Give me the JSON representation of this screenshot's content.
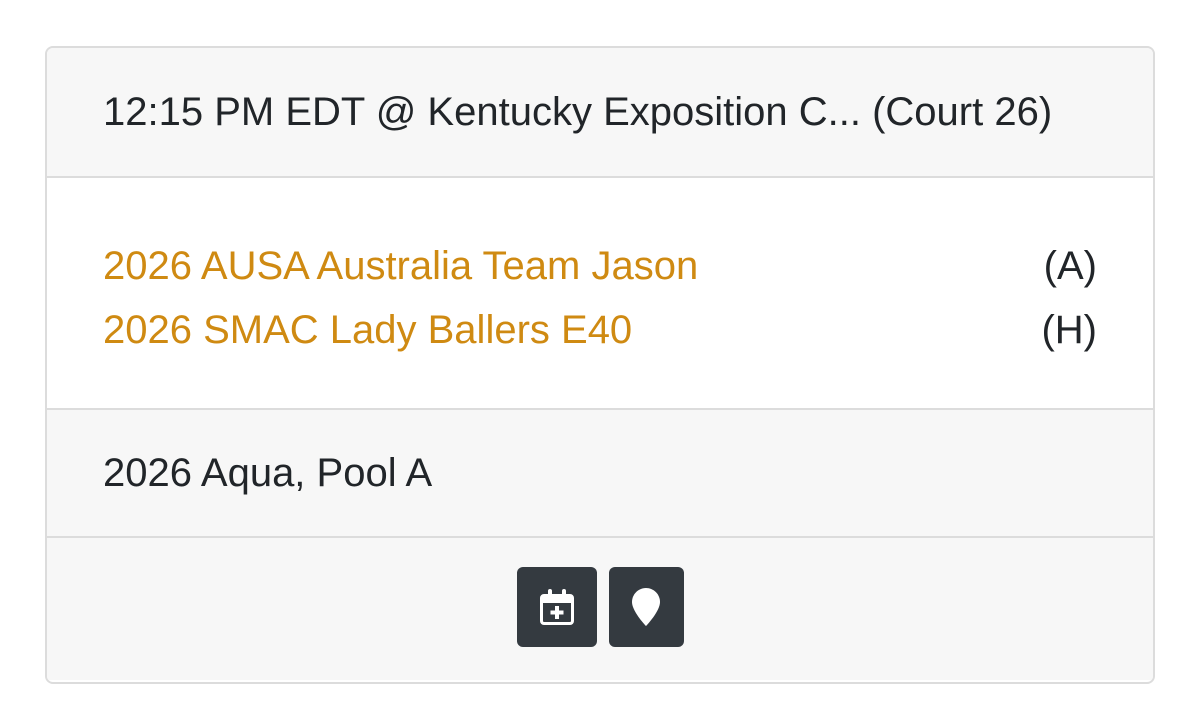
{
  "game": {
    "header": "12:15 PM EDT @ Kentucky Exposition C... (Court 26)",
    "teams": [
      {
        "name": "2026 AUSA Australia Team Jason",
        "side": "(A)"
      },
      {
        "name": "2026 SMAC Lady Ballers E40",
        "side": "(H)"
      }
    ],
    "pool": "2026 Aqua, Pool A",
    "actions": [
      {
        "icon": "calendar-plus-icon"
      },
      {
        "icon": "map-marker-icon"
      }
    ]
  },
  "colors": {
    "team_link": "#cf8a12",
    "button_bg": "#343a40",
    "panel_bg": "#f7f7f7",
    "border": "#dcdcdc"
  }
}
